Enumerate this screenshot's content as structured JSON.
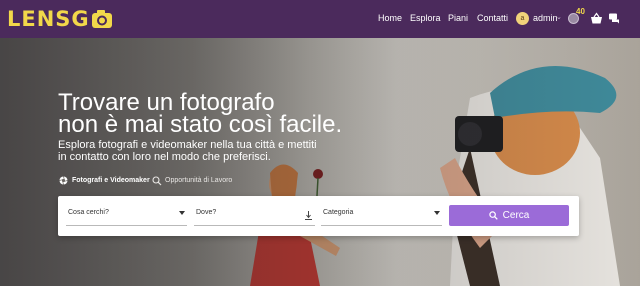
{
  "brand": {
    "logo_text": "LENSG"
  },
  "nav": {
    "links": [
      "Home",
      "Esplora",
      "Piani",
      "Contatti"
    ],
    "user": {
      "avatar_initial": "a",
      "name": "admin"
    },
    "coins": "40"
  },
  "hero": {
    "headline_line1": "Trovare un fotografo",
    "headline_line2": "non è mai stato così facile.",
    "subline": "Esplora fotografi e videomaker nella tua città e mettiti in contatto con loro nel modo che preferisci.",
    "tabs": [
      {
        "label": "Fotografi e Videomaker",
        "active": true,
        "icon": "aperture-icon"
      },
      {
        "label": "Opportunità di Lavoro",
        "active": false,
        "icon": "search-job-icon"
      }
    ]
  },
  "search": {
    "what_placeholder": "Cosa cerchi?",
    "where_placeholder": "Dove?",
    "category_placeholder": "Categoria",
    "button_label": "Cerca"
  },
  "colors": {
    "navbar": "#4b2a5c",
    "accent": "#9b6bd8",
    "logo": "#f2d84a"
  }
}
